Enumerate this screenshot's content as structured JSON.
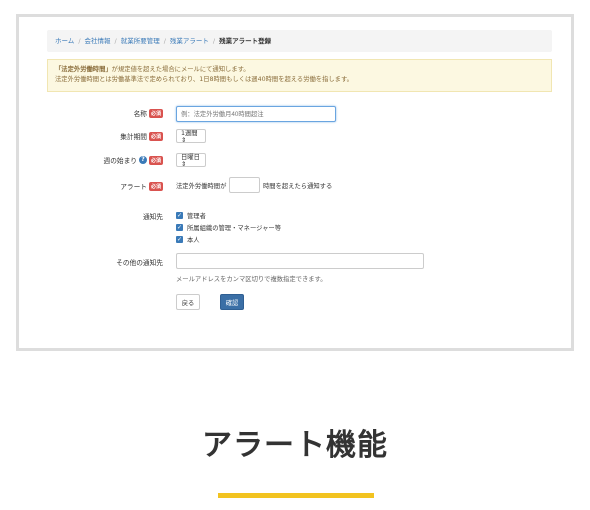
{
  "breadcrumb": [
    "ホーム",
    "会社情報",
    "就業所要管理",
    "残業アラート",
    "残業アラート登録"
  ],
  "alert": {
    "strong": "「法定外労働時間」",
    "line1_rest": "が規定値を超えた場合にメールにて通知します。",
    "line2": "法定外労働時間とは労働基準法で定められており、1日8時間もしくは週40時間を超える労働を指します。"
  },
  "required_badge": "必須",
  "help_icon_glyph": "?",
  "checkmark_glyph": "✓",
  "form": {
    "name_label": "名称",
    "name_placeholder": "例：法定外労働月40時間超注",
    "period_label": "集計期間",
    "period_value": "1週間 ⇕",
    "week_start_label": "週の始まり",
    "week_start_value": "日曜日 ⇕",
    "alert_label": "アラート",
    "alert_prefix": "法定外労働時間が",
    "alert_suffix": "時間を超えたら通知する",
    "notify_label": "通知先",
    "notify_options": [
      "管理者",
      "所属組織の管理・マネージャー等",
      "本人"
    ],
    "other_label": "その他の通知先",
    "other_help": "メールアドレスをカンマ区切りで複数指定できます。",
    "back_button": "戻る",
    "confirm_button": "確認"
  },
  "page_title": "アラート機能",
  "colors": {
    "accent": "#3a7ab8",
    "required": "#d9534f",
    "underline": "#f2c320",
    "alert_bg": "#fcf8e1"
  }
}
